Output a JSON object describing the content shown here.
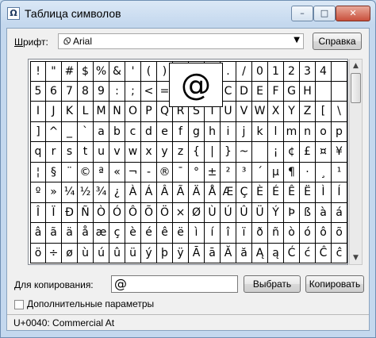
{
  "window": {
    "title": "Таблица символов",
    "app_icon": "charmap-icon"
  },
  "titlebar_buttons": {
    "minimize": "–",
    "maximize": "□",
    "close": "✕"
  },
  "font": {
    "label": "Шрифт:",
    "label_accel": "Ш",
    "label_rest": "рифт:",
    "selected": "Arial",
    "font_icon": "Ꮻ",
    "dropdown_caret": "▼"
  },
  "help_button": "Справка",
  "magnified_char": "@",
  "grid": [
    [
      "!",
      "\"",
      "#",
      "$",
      "%",
      "&",
      "'",
      "(",
      ")",
      "*",
      "",
      "",
      "",
      ",",
      "-",
      ".",
      "/",
      "0",
      "1",
      "2",
      "3",
      "4"
    ],
    [
      "5",
      "6",
      "7",
      "8",
      "9",
      ":",
      ";",
      "<",
      "=",
      ">",
      "",
      "",
      "",
      "A",
      "B",
      "C",
      "D",
      "E",
      "F",
      "G",
      "H"
    ],
    [
      "I",
      "J",
      "K",
      "L",
      "M",
      "N",
      "O",
      "P",
      "Q",
      "R",
      "S",
      "T",
      "U",
      "V",
      "W",
      "X",
      "Y",
      "Z",
      "[",
      "\\"
    ],
    [
      "]",
      "^",
      "_",
      "`",
      "a",
      "b",
      "c",
      "d",
      "e",
      "f",
      "g",
      "h",
      "i",
      "j",
      "k",
      "l",
      "m",
      "n",
      "o",
      "p"
    ],
    [
      "q",
      "r",
      "s",
      "t",
      "u",
      "v",
      "w",
      "x",
      "y",
      "z",
      "{",
      "|",
      "}",
      "~",
      " ",
      "¡",
      "¢",
      "£",
      "¤",
      "¥"
    ],
    [
      "¦",
      "§",
      "¨",
      "©",
      "ª",
      "«",
      "¬",
      "-",
      "®",
      "¯",
      "°",
      "±",
      "²",
      "³",
      "´",
      "µ",
      "¶",
      "·",
      "¸",
      "¹"
    ],
    [
      "º",
      "»",
      "¼",
      "½",
      "¾",
      "¿",
      "À",
      "Á",
      "Â",
      "Ã",
      "Ä",
      "Å",
      "Æ",
      "Ç",
      "È",
      "É",
      "Ê",
      "Ë",
      "Ì",
      "Í"
    ],
    [
      "Î",
      "Ï",
      "Ð",
      "Ñ",
      "Ò",
      "Ó",
      "Ô",
      "Õ",
      "Ö",
      "×",
      "Ø",
      "Ù",
      "Ú",
      "Û",
      "Ü",
      "Ý",
      "Þ",
      "ß",
      "à",
      "á"
    ],
    [
      "â",
      "ã",
      "ä",
      "å",
      "æ",
      "ç",
      "è",
      "é",
      "ê",
      "ë",
      "ì",
      "í",
      "î",
      "ï",
      "ð",
      "ñ",
      "ò",
      "ó",
      "ô",
      "õ"
    ],
    [
      "ö",
      "÷",
      "ø",
      "ù",
      "ú",
      "û",
      "ü",
      "ý",
      "þ",
      "ÿ",
      "Ā",
      "ā",
      "Ă",
      "ă",
      "Ą",
      "ą",
      "Ć",
      "ć",
      "Ĉ",
      "ĉ"
    ]
  ],
  "scrollbar": {
    "up": "▲",
    "down": "▼"
  },
  "copy": {
    "label": "Для копирования:",
    "value": "@",
    "select_button": "Выбрать",
    "copy_button": "Копировать"
  },
  "advanced": {
    "label": "Дополнительные параметры",
    "checked": false
  },
  "status": "U+0040: Commercial At"
}
